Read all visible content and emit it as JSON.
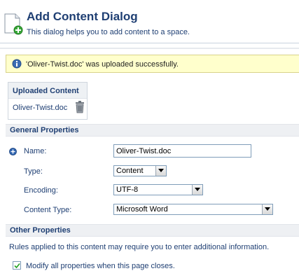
{
  "header": {
    "title": "Add Content Dialog",
    "description": "This dialog helps you to add content to a space."
  },
  "message": {
    "text": "'Oliver-Twist.doc' was uploaded successfully.",
    "icon": "info-icon"
  },
  "uploaded": {
    "title": "Uploaded Content",
    "file_name": "Oliver-Twist.doc",
    "icon": "trash-icon"
  },
  "general": {
    "title": "General Properties",
    "name_label": "Name:",
    "name_value": "Oliver-Twist.doc",
    "type_label": "Type:",
    "type_value": "Content",
    "encoding_label": "Encoding:",
    "encoding_value": "UTF-8",
    "content_type_label": "Content Type:",
    "content_type_value": "Microsoft Word"
  },
  "other": {
    "title": "Other Properties",
    "rules_text": "Rules applied to this content may require you to enter additional information.",
    "modify_label": "Modify all properties when this page closes.",
    "modify_checked": true
  },
  "colors": {
    "title_blue": "#1f3f73",
    "message_bg": "#ffffcc",
    "section_bg": "#eef0f3"
  }
}
